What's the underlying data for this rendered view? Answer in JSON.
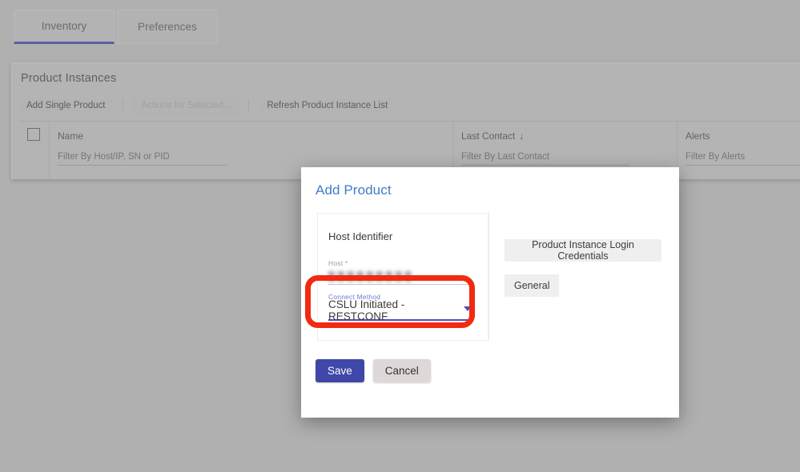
{
  "tabs": [
    {
      "label": "Inventory",
      "active": true
    },
    {
      "label": "Preferences",
      "active": false
    }
  ],
  "panel": {
    "title": "Product Instances",
    "toolbar": {
      "add_label": "Add Single Product",
      "actions_label": "Actions for Selected...",
      "refresh_label": "Refresh Product Instance List"
    },
    "table": {
      "columns": [
        {
          "label": "Name",
          "filter_placeholder": "Filter By Host/IP, SN or PID",
          "sort": ""
        },
        {
          "label": "Last Contact",
          "filter_placeholder": "Filter By Last Contact",
          "sort": "↓"
        },
        {
          "label": "Alerts",
          "filter_placeholder": "Filter By Alerts",
          "sort": ""
        }
      ]
    }
  },
  "modal": {
    "title": "Add Product",
    "host_section": {
      "heading": "Host Identifier",
      "host_label": "Host *",
      "host_value": "",
      "connect_label": "Connect Method",
      "connect_value": "CSLU Initiated - RESTCONF"
    },
    "side_buttons": [
      {
        "label": "Product Instance Login Credentials"
      },
      {
        "label": "General"
      }
    ],
    "actions": {
      "save_label": "Save",
      "cancel_label": "Cancel"
    }
  },
  "colors": {
    "accent_blue": "#3d7cc9",
    "primary_button": "#3f47a8",
    "field_focus": "#4a53b8",
    "annotation_red": "#f02b10"
  }
}
